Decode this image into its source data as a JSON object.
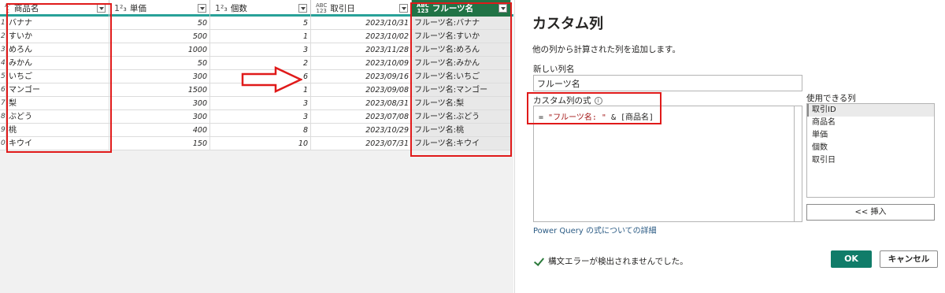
{
  "grid": {
    "columns": [
      {
        "type_icon": "Aᴮ\nc",
        "label": "商品名"
      },
      {
        "type_icon": "1²₃",
        "label": "単価"
      },
      {
        "type_icon": "1²₃",
        "label": "個数"
      },
      {
        "type_icon": "ABC\n123",
        "label": "取引日"
      },
      {
        "type_icon": "ABC\n123",
        "label": "フルーツ名"
      }
    ],
    "rows": [
      {
        "num": "1",
        "name": "バナナ",
        "price": "50",
        "qty": "5",
        "date": "2023/10/31",
        "fruit": "フルーツ名:バナナ"
      },
      {
        "num": "2",
        "name": "すいか",
        "price": "500",
        "qty": "1",
        "date": "2023/10/02",
        "fruit": "フルーツ名:すいか"
      },
      {
        "num": "3",
        "name": "めろん",
        "price": "1000",
        "qty": "3",
        "date": "2023/11/28",
        "fruit": "フルーツ名:めろん"
      },
      {
        "num": "4",
        "name": "みかん",
        "price": "50",
        "qty": "2",
        "date": "2023/10/09",
        "fruit": "フルーツ名:みかん"
      },
      {
        "num": "5",
        "name": "いちご",
        "price": "300",
        "qty": "6",
        "date": "2023/09/16",
        "fruit": "フルーツ名:いちご"
      },
      {
        "num": "6",
        "name": "マンゴー",
        "price": "1500",
        "qty": "1",
        "date": "2023/09/08",
        "fruit": "フルーツ名:マンゴー"
      },
      {
        "num": "7",
        "name": "梨",
        "price": "300",
        "qty": "3",
        "date": "2023/08/31",
        "fruit": "フルーツ名:梨"
      },
      {
        "num": "8",
        "name": "ぶどう",
        "price": "300",
        "qty": "3",
        "date": "2023/07/08",
        "fruit": "フルーツ名:ぶどう"
      },
      {
        "num": "9",
        "name": "桃",
        "price": "400",
        "qty": "8",
        "date": "2023/10/29",
        "fruit": "フルーツ名:桃"
      },
      {
        "num": "0",
        "name": "キウイ",
        "price": "150",
        "qty": "10",
        "date": "2023/07/31",
        "fruit": "フルーツ名:キウイ"
      }
    ]
  },
  "dialog": {
    "title": "カスタム列",
    "description": "他の列から計算された列を追加します。",
    "new_column_label": "新しい列名",
    "new_column_value": "フルーツ名",
    "formula_label": "カスタム列の式",
    "formula_prefix": "= ",
    "formula_string": "\"フルーツ名: \"",
    "formula_suffix": " & [商品名]",
    "available_label": "使用できる列",
    "available_columns": [
      "取引ID",
      "商品名",
      "単価",
      "個数",
      "取引日"
    ],
    "insert_button": "<< 挿入",
    "link": "Power Query の式についての詳細",
    "status": "構文エラーが検出されませんでした。",
    "ok_button": "OK",
    "cancel_button": "キャンセル"
  },
  "colors": {
    "accent_teal": "#28a198",
    "highlight_red": "#e01a1a",
    "ok_green": "#107c69"
  }
}
